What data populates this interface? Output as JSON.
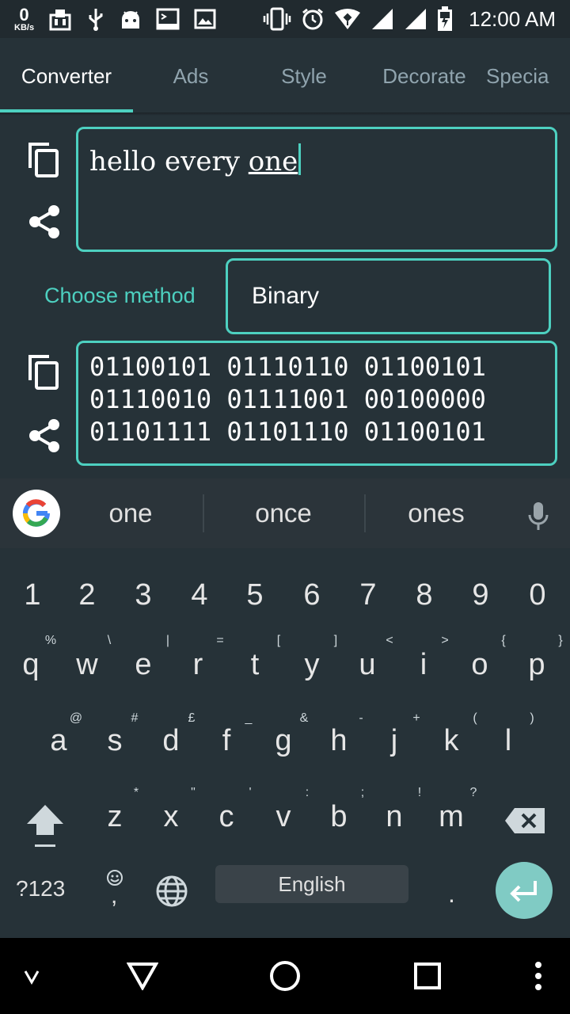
{
  "status_bar": {
    "speed_value": "0",
    "speed_unit": "KB/s",
    "time": "12:00 AM"
  },
  "tabs": [
    {
      "label": "Converter",
      "active": true
    },
    {
      "label": "Ads",
      "active": false
    },
    {
      "label": "Style",
      "active": false
    },
    {
      "label": "Decorate",
      "active": false
    },
    {
      "label": "Specia",
      "active": false
    }
  ],
  "converter": {
    "input_prefix": "hello every ",
    "input_underlined": "one",
    "choose_method_label": "Choose method",
    "method_value": "Binary",
    "output_line1": "01100101 01110110 01100101",
    "output_line2": "01110010 01111001 00100000",
    "output_line3": "01101111 01101110 01100101"
  },
  "suggestions": [
    "one",
    "once",
    "ones"
  ],
  "keyboard": {
    "numbers": [
      "1",
      "2",
      "3",
      "4",
      "5",
      "6",
      "7",
      "8",
      "9",
      "0"
    ],
    "row1": [
      "q",
      "w",
      "e",
      "r",
      "t",
      "y",
      "u",
      "i",
      "o",
      "p"
    ],
    "row1_hints": [
      "%",
      "\\",
      "|",
      "=",
      "[",
      "]",
      "<",
      ">",
      "{",
      "}"
    ],
    "row2": [
      "a",
      "s",
      "d",
      "f",
      "g",
      "h",
      "j",
      "k",
      "l"
    ],
    "row2_hints": [
      "@",
      "#",
      "£",
      "_",
      "&",
      "-",
      "+",
      "(",
      ")"
    ],
    "row3": [
      "z",
      "x",
      "c",
      "v",
      "b",
      "n",
      "m"
    ],
    "row3_hints": [
      "*",
      "\"",
      "'",
      ":",
      ";",
      "!",
      "?"
    ],
    "symbols_label": "?123",
    "comma": ",",
    "space_label": "English",
    "period": "."
  },
  "colors": {
    "accent": "#4dd0c0",
    "background": "#263238",
    "status_bar": "#212a2f"
  }
}
